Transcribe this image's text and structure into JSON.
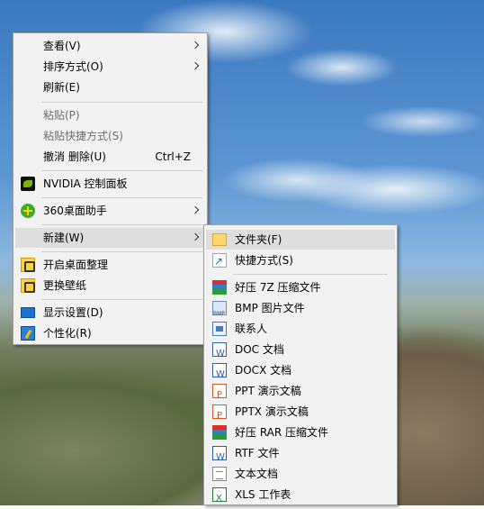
{
  "context_menu": {
    "items": [
      {
        "label": "查看(V)",
        "has_submenu": true
      },
      {
        "label": "排序方式(O)",
        "has_submenu": true
      },
      {
        "label": "刷新(E)"
      },
      {
        "label": "粘贴(P)",
        "disabled": true
      },
      {
        "label": "粘贴快捷方式(S)",
        "disabled": true
      },
      {
        "label": "撤消 删除(U)",
        "shortcut": "Ctrl+Z"
      },
      {
        "label": "NVIDIA 控制面板",
        "icon": "nvidia-icon"
      },
      {
        "label": "360桌面助手",
        "icon": "360-icon",
        "has_submenu": true
      },
      {
        "label": "新建(W)",
        "has_submenu": true,
        "highlighted": true
      },
      {
        "label": "开启桌面整理",
        "icon": "haozip-organize-icon"
      },
      {
        "label": "更换壁纸",
        "icon": "wallpaper-icon"
      },
      {
        "label": "显示设置(D)",
        "icon": "display-icon"
      },
      {
        "label": "个性化(R)",
        "icon": "personalize-icon"
      }
    ]
  },
  "new_submenu": {
    "items": [
      {
        "label": "文件夹(F)",
        "icon": "folder-icon",
        "highlighted": true
      },
      {
        "label": "快捷方式(S)",
        "icon": "shortcut-icon"
      },
      {
        "label": "好压 7Z 压缩文件",
        "icon": "7z-archive-icon"
      },
      {
        "label": "BMP 图片文件",
        "icon": "bmp-icon"
      },
      {
        "label": "联系人",
        "icon": "contact-icon"
      },
      {
        "label": "DOC 文档",
        "icon": "doc-icon"
      },
      {
        "label": "DOCX 文档",
        "icon": "docx-icon"
      },
      {
        "label": "PPT 演示文稿",
        "icon": "ppt-icon"
      },
      {
        "label": "PPTX 演示文稿",
        "icon": "pptx-icon"
      },
      {
        "label": "好压 RAR 压缩文件",
        "icon": "rar-archive-icon"
      },
      {
        "label": "RTF 文件",
        "icon": "rtf-icon"
      },
      {
        "label": "文本文档",
        "icon": "txt-icon"
      },
      {
        "label": "XLS 工作表",
        "icon": "xls-icon"
      }
    ]
  }
}
